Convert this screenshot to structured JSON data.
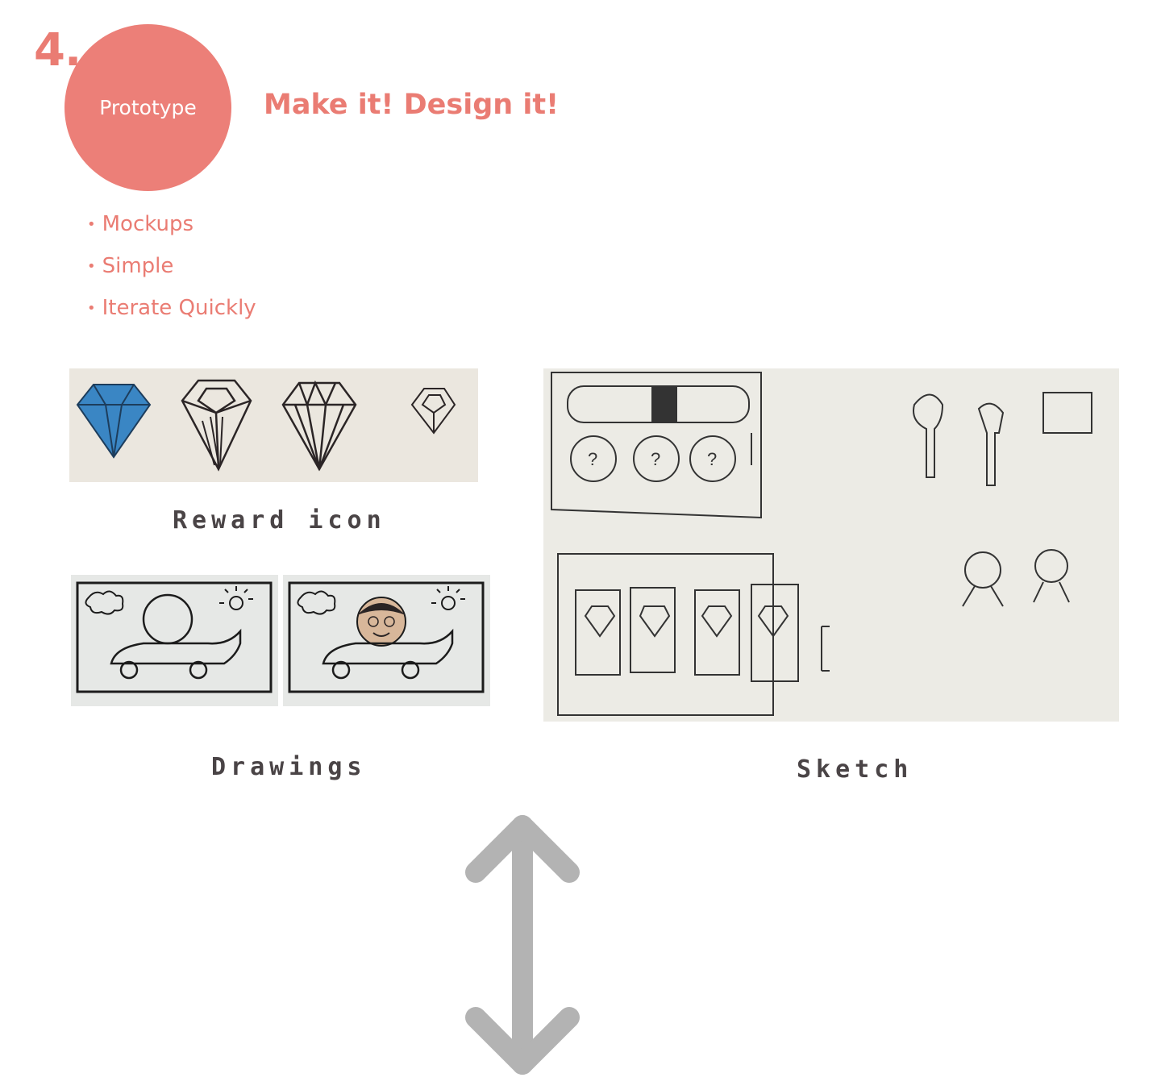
{
  "header": {
    "step_number": "4.",
    "step_label": "Prototype",
    "headline": "Make it! Design it!"
  },
  "bullets": [
    {
      "label": "Mockups"
    },
    {
      "label": "Simple"
    },
    {
      "label": "Iterate Quickly"
    }
  ],
  "bullet_symbol": "•",
  "captions": {
    "reward_icon": "Reward icon",
    "drawings": "Drawings",
    "sketch": "Sketch"
  },
  "colors": {
    "accent": "#ec7f78",
    "caption_text": "#4a4446",
    "arrow": "#b3b3b3",
    "diamond_blue": "#3a86c4"
  },
  "icons": {
    "arrow": "double-vertical-arrow-icon"
  }
}
